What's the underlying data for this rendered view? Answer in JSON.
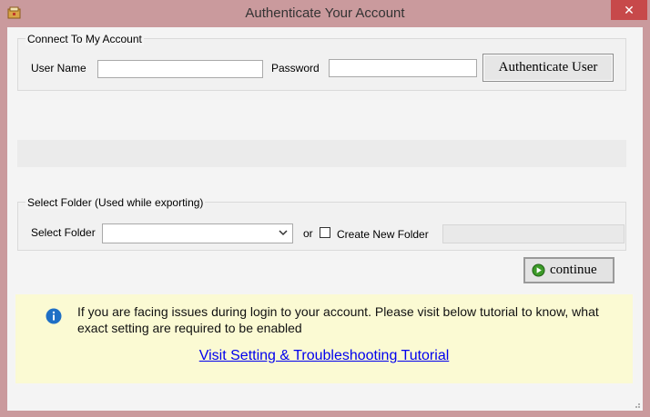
{
  "window": {
    "title": "Authenticate Your Account",
    "close_label": "✕"
  },
  "account_group": {
    "legend": "Connect To My Account",
    "username_label": "User Name",
    "username_value": "",
    "password_label": "Password",
    "password_value": "",
    "auth_button": "Authenticate User"
  },
  "progress": {
    "fraction": 0
  },
  "folder_group": {
    "legend": "Select Folder (Used while exporting)",
    "select_label": "Select Folder",
    "select_value": "",
    "or_label": "or",
    "create_checkbox_label": "Create New Folder",
    "create_checked": false,
    "new_folder_value": ""
  },
  "continue_button": "continue",
  "info": {
    "message": "If you are facing issues during login to your account. Please visit below tutorial to know, what exact setting are required to be enabled",
    "link": "Visit Setting & Troubleshooting Tutorial"
  },
  "colors": {
    "frame": "#ca9a9d",
    "close": "#c7494a",
    "info_bg": "#fbfad3",
    "info_icon": "#1f6fc5",
    "go_icon": "#3c9a28"
  }
}
